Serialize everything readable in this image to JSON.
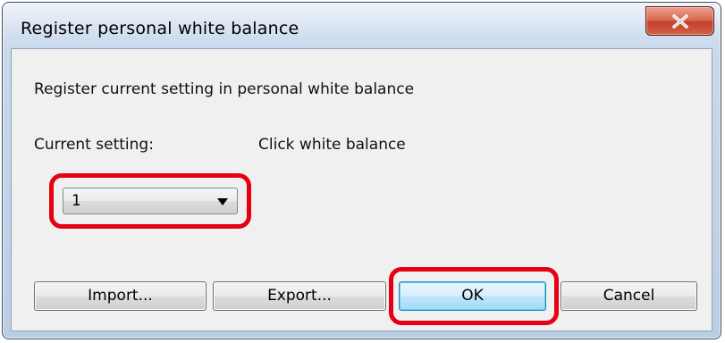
{
  "window": {
    "title": "Register personal white balance",
    "close_icon": "close-icon"
  },
  "dialog": {
    "description": "Register current setting in personal white balance",
    "current_setting_label": "Current setting:",
    "current_setting_value": "Click white balance",
    "slot_select": {
      "selected": "1",
      "icon": "dropdown-arrow-icon"
    }
  },
  "buttons": {
    "import_label": "Import...",
    "export_label": "Export...",
    "ok_label": "OK",
    "cancel_label": "Cancel"
  },
  "colors": {
    "highlight": "#e60012",
    "close_button": "#c2412a",
    "default_button_border": "#3c7fb1"
  }
}
